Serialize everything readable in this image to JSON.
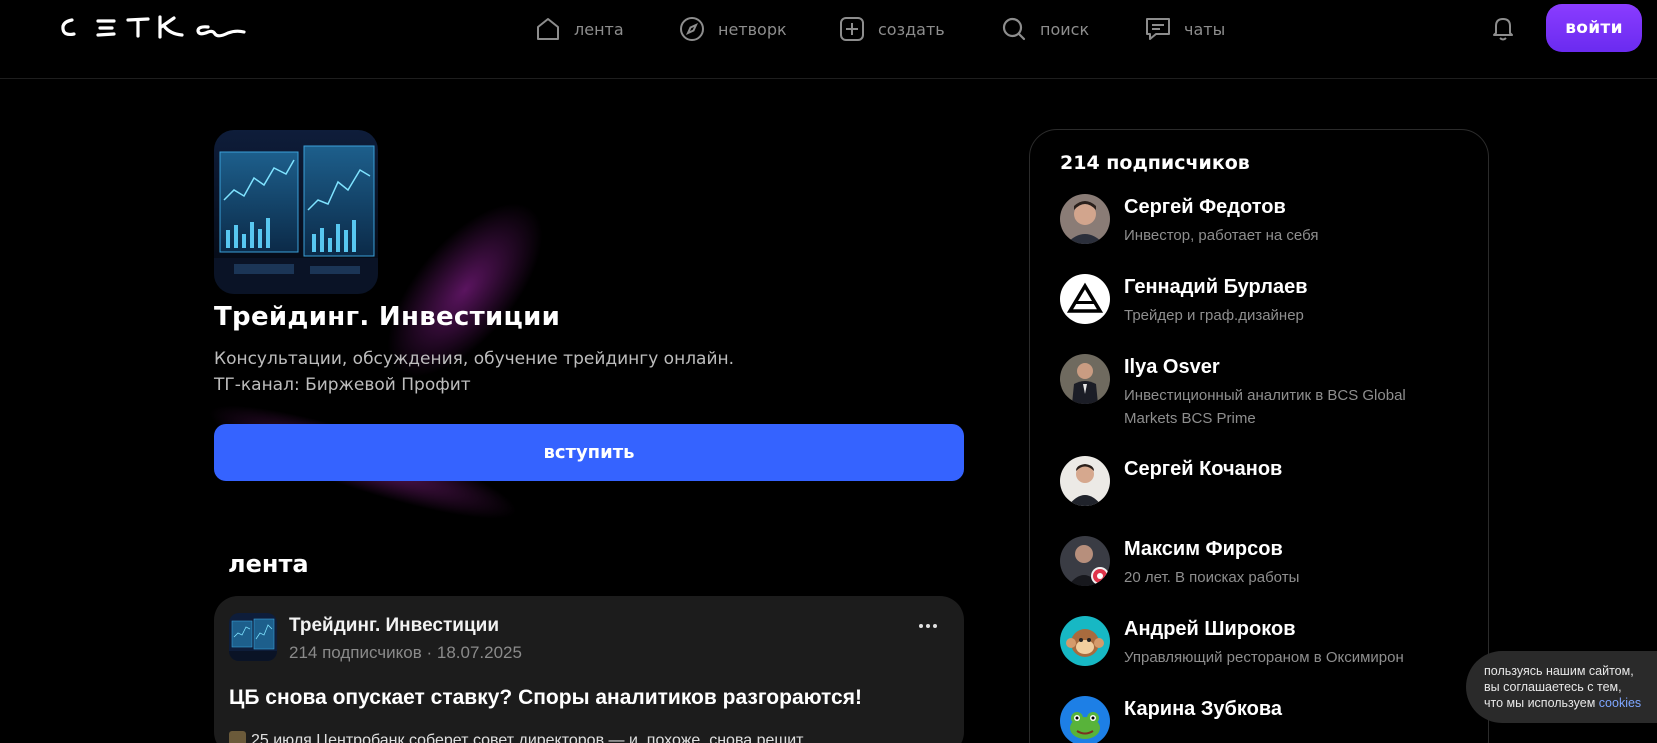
{
  "header": {
    "logo_text": "сетка",
    "nav": [
      {
        "label": "лента",
        "icon": "home-icon"
      },
      {
        "label": "нетворк",
        "icon": "compass-icon"
      },
      {
        "label": "создать",
        "icon": "plus-square-icon"
      },
      {
        "label": "поиск",
        "icon": "search-icon"
      },
      {
        "label": "чаты",
        "icon": "chat-icon"
      }
    ],
    "notifications_icon": "bell-icon",
    "login_label": "войти"
  },
  "group": {
    "title": "Трейдинг. Инвестиции",
    "description_line1": "Консультации, обсуждения, обучение трейдингу онлайн.",
    "description_line2": "ТГ-канал: Биржевой Профит",
    "join_label": "вступить"
  },
  "feed": {
    "heading": "лента",
    "post": {
      "author": "Трейдинг. Инвестиции",
      "meta": "214 подписчиков · 18.07.2025",
      "title": "ЦБ снова опускает ставку? Споры аналитиков разгораются!",
      "text": "25 июля Центробанк соберет совет директоров — и, похоже, снова решит"
    }
  },
  "subscribers": {
    "title": "214 подписчиков",
    "items": [
      {
        "name": "Сергей Федотов",
        "role": "Инвестор, работает на себя"
      },
      {
        "name": "Геннадий Бурлаев",
        "role": "Трейдер и граф.дизайнер"
      },
      {
        "name": "Ilya Osver",
        "role": "Инвестиционный аналитик в BCS Global Markets BCS Prime"
      },
      {
        "name": "Сергей Кочанов",
        "role": ""
      },
      {
        "name": "Максим Фирсов",
        "role": "20 лет. В поисках работы"
      },
      {
        "name": "Андрей Широков",
        "role": "Управляющий рестораном в Оксимирон"
      },
      {
        "name": "Карина Зубкова",
        "role": ""
      }
    ]
  },
  "cookie": {
    "line1": "пользуясь нашим сайтом,",
    "line2": "вы соглашаетесь с тем,",
    "line3": "что мы используем",
    "link": "cookies"
  },
  "colors": {
    "accent_purple": "#7b35fa",
    "join_blue": "#3563ff",
    "card_bg": "#1c1c1c"
  }
}
